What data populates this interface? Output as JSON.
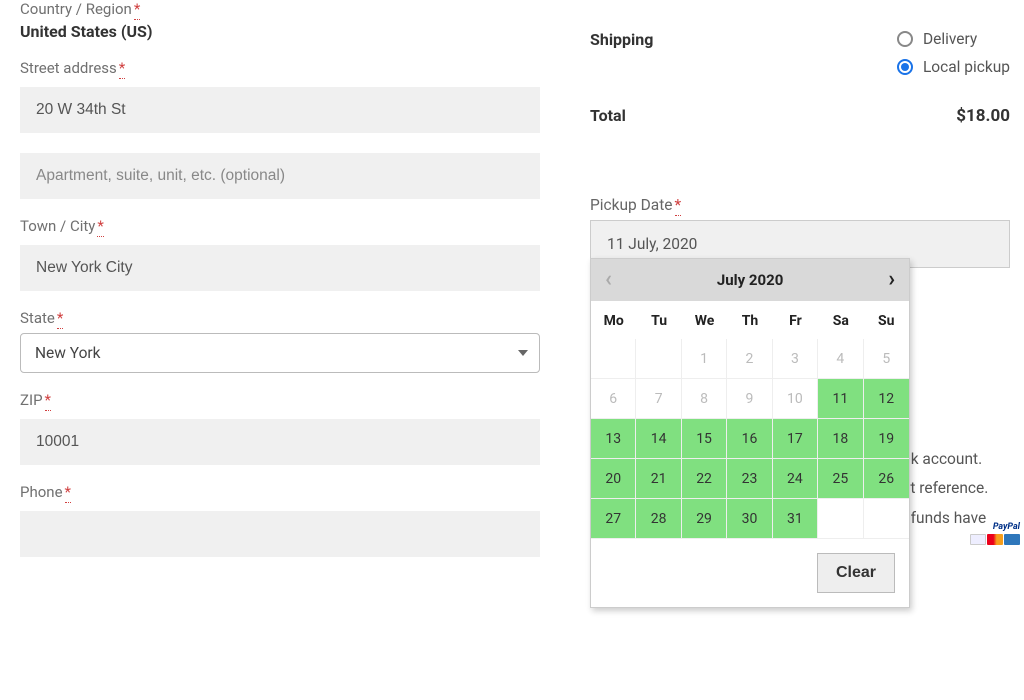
{
  "billing": {
    "country_label": "Country / Region",
    "country_value": "United States (US)",
    "street_label": "Street address",
    "street_value": "20 W 34th St",
    "street2_placeholder": "Apartment, suite, unit, etc. (optional)",
    "city_label": "Town / City",
    "city_value": "New York City",
    "state_label": "State",
    "state_value": "New York",
    "zip_label": "ZIP",
    "zip_value": "10001",
    "phone_label": "Phone"
  },
  "order": {
    "shipping_label": "Shipping",
    "ship_option_delivery": "Delivery",
    "ship_option_pickup": "Local pickup",
    "total_label": "Total",
    "total_value": "$18.00"
  },
  "pickup": {
    "label": "Pickup Date",
    "value": "11 July, 2020"
  },
  "calendar": {
    "month_title": "July 2020",
    "clear_label": "Clear",
    "dow": [
      "Mo",
      "Tu",
      "We",
      "Th",
      "Fr",
      "Sa",
      "Su"
    ],
    "cells": [
      {
        "d": "",
        "s": "blank"
      },
      {
        "d": "",
        "s": "blank"
      },
      {
        "d": "1",
        "s": "dis"
      },
      {
        "d": "2",
        "s": "dis"
      },
      {
        "d": "3",
        "s": "dis"
      },
      {
        "d": "4",
        "s": "dis"
      },
      {
        "d": "5",
        "s": "dis"
      },
      {
        "d": "6",
        "s": "dis"
      },
      {
        "d": "7",
        "s": "dis"
      },
      {
        "d": "8",
        "s": "dis"
      },
      {
        "d": "9",
        "s": "dis"
      },
      {
        "d": "10",
        "s": "dis"
      },
      {
        "d": "11",
        "s": "avail"
      },
      {
        "d": "12",
        "s": "avail"
      },
      {
        "d": "13",
        "s": "avail"
      },
      {
        "d": "14",
        "s": "avail"
      },
      {
        "d": "15",
        "s": "avail"
      },
      {
        "d": "16",
        "s": "avail"
      },
      {
        "d": "17",
        "s": "avail"
      },
      {
        "d": "18",
        "s": "avail"
      },
      {
        "d": "19",
        "s": "avail"
      },
      {
        "d": "20",
        "s": "avail"
      },
      {
        "d": "21",
        "s": "avail"
      },
      {
        "d": "22",
        "s": "avail"
      },
      {
        "d": "23",
        "s": "avail"
      },
      {
        "d": "24",
        "s": "avail"
      },
      {
        "d": "25",
        "s": "avail"
      },
      {
        "d": "26",
        "s": "avail"
      },
      {
        "d": "27",
        "s": "avail"
      },
      {
        "d": "28",
        "s": "avail"
      },
      {
        "d": "29",
        "s": "avail"
      },
      {
        "d": "30",
        "s": "avail"
      },
      {
        "d": "31",
        "s": "avail"
      },
      {
        "d": "",
        "s": "blank"
      },
      {
        "d": "",
        "s": "blank"
      }
    ]
  },
  "bg": {
    "line1": "bank account.",
    "line2": "nent reference.",
    "line3": "the funds have"
  },
  "pay": {
    "pp": "PayPal",
    "visa": "VISA"
  },
  "misc": {
    "star": "*"
  }
}
